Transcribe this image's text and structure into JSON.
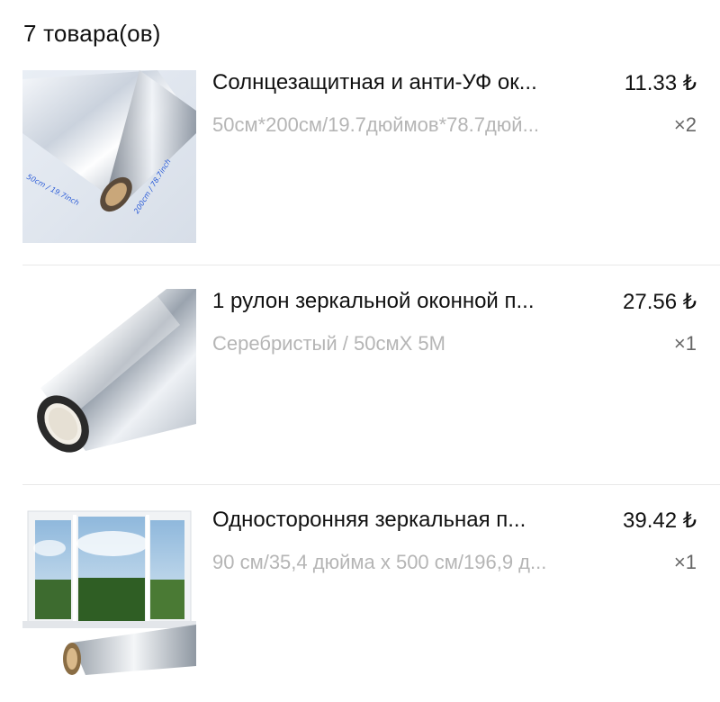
{
  "header": {
    "count_label": "7 товара(ов)"
  },
  "items": [
    {
      "title": "Солнцезащитная и анти-УФ ок...",
      "price": "11.33 ₺",
      "variant": "50см*200см/19.7дюймов*78.7дюй...",
      "qty": "×2",
      "image_labels": [
        "50cm / 19.7inch",
        "200cm / 78.7inch"
      ]
    },
    {
      "title": "1 рулон зеркальной оконной п...",
      "price": "27.56 ₺",
      "variant": "Серебристый / 50смX 5M",
      "qty": "×1"
    },
    {
      "title": "Односторонняя зеркальная п...",
      "price": "39.42 ₺",
      "variant": "90 см/35,4 дюйма x 500 см/196,9 д...",
      "qty": "×1"
    }
  ],
  "colors": {
    "text_primary": "#111111",
    "text_secondary": "#b5b5b5",
    "divider": "#e8e8e8"
  }
}
